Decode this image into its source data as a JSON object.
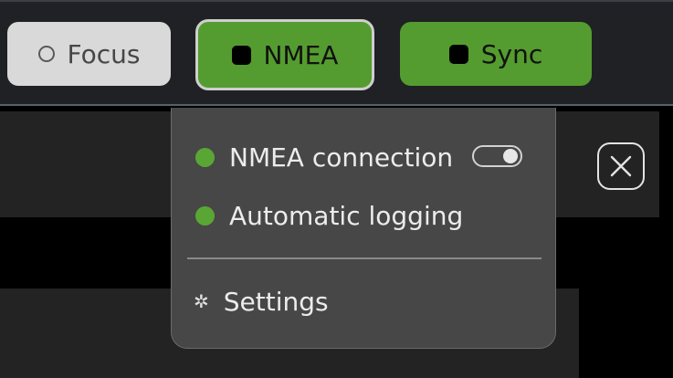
{
  "toolbar": {
    "focus_label": "Focus",
    "nmea_label": "NMEA",
    "sync_label": "Sync",
    "accent_color": "#549c2f"
  },
  "dropdown": {
    "items": [
      {
        "label": "NMEA connection",
        "status": "active",
        "toggle_on": true
      },
      {
        "label": "Automatic logging",
        "status": "active"
      }
    ],
    "settings_label": "Settings"
  },
  "icons": {
    "focus": "circle-outline-icon",
    "nmea": "stop-square-icon",
    "sync": "stop-square-icon",
    "close": "close-icon",
    "settings": "gear-icon"
  }
}
